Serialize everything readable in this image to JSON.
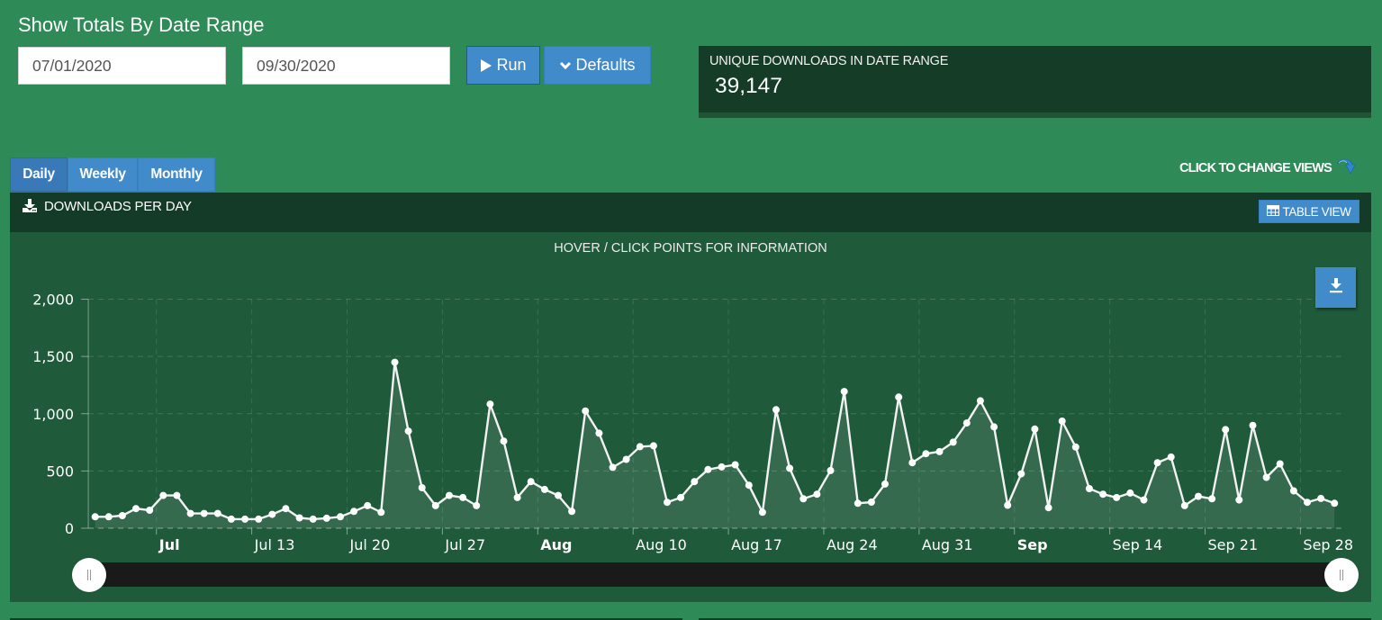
{
  "page": {
    "title": "Show Totals By Date Range"
  },
  "date_range": {
    "start_value": "07/01/2020",
    "end_value": "09/30/2020",
    "run_label": "Run",
    "defaults_label": "Defaults"
  },
  "stat": {
    "label": "UNIQUE DOWNLOADS IN DATE RANGE",
    "value": "39,147"
  },
  "view_tabs": [
    {
      "label": "Daily",
      "active": true
    },
    {
      "label": "Weekly",
      "active": false
    },
    {
      "label": "Monthly",
      "active": false
    }
  ],
  "change_views_hint": "CLICK TO CHANGE VIEWS",
  "panel": {
    "title": "DOWNLOADS PER DAY",
    "table_view_label": "TABLE VIEW"
  },
  "navigator": {
    "range_start": "2020-07-01",
    "range_end": "2020-09-30",
    "selected_fraction": [
      0,
      1
    ]
  },
  "icons": {
    "run": "play-icon",
    "defaults": "chevron-down-icon",
    "change_views": "curved-arrow-down-icon",
    "panel_title": "download-tray-icon",
    "table_view": "table-grid-icon",
    "export": "download-icon",
    "navigator_handle": "grip-icon"
  },
  "colors": {
    "page_background": "#2e8b57",
    "panel_background": "#1f5a3b",
    "panel_header": "#143b27",
    "accent_button": "#428bca",
    "series_line": "#f2f2f2",
    "navigator_track": "#1a1a1a"
  },
  "chart_data": {
    "type": "area",
    "title": "HOVER / CLICK POINTS FOR INFORMATION",
    "xlabel": "",
    "ylabel": "",
    "ylim": [
      0,
      2000
    ],
    "grid": true,
    "legend": "none",
    "markers": true,
    "y_ticks": [
      {
        "value": 0,
        "label": "0"
      },
      {
        "value": 500,
        "label": "500"
      },
      {
        "value": 1000,
        "label": "1,000"
      },
      {
        "value": 1500,
        "label": "1,500"
      },
      {
        "value": 2000,
        "label": "2,000"
      }
    ],
    "x_ticks": [
      {
        "date": "2020-07-06",
        "label": "Jul"
      },
      {
        "date": "2020-07-13",
        "label": "Jul 13"
      },
      {
        "date": "2020-07-20",
        "label": "Jul 20"
      },
      {
        "date": "2020-07-27",
        "label": "Jul 27"
      },
      {
        "date": "2020-08-03",
        "label": "Aug"
      },
      {
        "date": "2020-08-10",
        "label": "Aug 10"
      },
      {
        "date": "2020-08-17",
        "label": "Aug 17"
      },
      {
        "date": "2020-08-24",
        "label": "Aug 24"
      },
      {
        "date": "2020-08-31",
        "label": "Aug 31"
      },
      {
        "date": "2020-09-07",
        "label": "Sep"
      },
      {
        "date": "2020-09-14",
        "label": "Sep 14"
      },
      {
        "date": "2020-09-21",
        "label": "Sep 21"
      },
      {
        "date": "2020-09-28",
        "label": "Sep 28"
      }
    ],
    "series_name": "Downloads",
    "x": [
      "2020-07-01",
      "2020-07-02",
      "2020-07-03",
      "2020-07-04",
      "2020-07-05",
      "2020-07-06",
      "2020-07-07",
      "2020-07-08",
      "2020-07-09",
      "2020-07-10",
      "2020-07-11",
      "2020-07-12",
      "2020-07-13",
      "2020-07-14",
      "2020-07-15",
      "2020-07-16",
      "2020-07-17",
      "2020-07-18",
      "2020-07-19",
      "2020-07-20",
      "2020-07-21",
      "2020-07-22",
      "2020-07-23",
      "2020-07-24",
      "2020-07-25",
      "2020-07-26",
      "2020-07-27",
      "2020-07-28",
      "2020-07-29",
      "2020-07-30",
      "2020-07-31",
      "2020-08-01",
      "2020-08-02",
      "2020-08-03",
      "2020-08-04",
      "2020-08-05",
      "2020-08-06",
      "2020-08-07",
      "2020-08-08",
      "2020-08-09",
      "2020-08-10",
      "2020-08-11",
      "2020-08-12",
      "2020-08-13",
      "2020-08-14",
      "2020-08-15",
      "2020-08-16",
      "2020-08-17",
      "2020-08-18",
      "2020-08-19",
      "2020-08-20",
      "2020-08-21",
      "2020-08-22",
      "2020-08-23",
      "2020-08-24",
      "2020-08-25",
      "2020-08-26",
      "2020-08-27",
      "2020-08-28",
      "2020-08-29",
      "2020-08-30",
      "2020-08-31",
      "2020-09-01",
      "2020-09-02",
      "2020-09-03",
      "2020-09-04",
      "2020-09-05",
      "2020-09-06",
      "2020-09-07",
      "2020-09-08",
      "2020-09-09",
      "2020-09-10",
      "2020-09-11",
      "2020-09-12",
      "2020-09-13",
      "2020-09-14",
      "2020-09-15",
      "2020-09-16",
      "2020-09-17",
      "2020-09-18",
      "2020-09-19",
      "2020-09-20",
      "2020-09-21",
      "2020-09-22",
      "2020-09-23",
      "2020-09-24",
      "2020-09-25",
      "2020-09-26",
      "2020-09-27",
      "2020-09-28",
      "2020-09-29",
      "2020-09-30"
    ],
    "values": [
      100,
      100,
      110,
      171,
      157,
      286,
      286,
      129,
      129,
      129,
      79,
      79,
      79,
      121,
      171,
      90,
      79,
      87,
      100,
      147,
      197,
      139,
      1449,
      848,
      354,
      197,
      286,
      268,
      197,
      1084,
      761,
      268,
      407,
      339,
      286,
      147,
      1024,
      830,
      531,
      601,
      712,
      720,
      226,
      268,
      407,
      512,
      535,
      554,
      376,
      139,
      1035,
      523,
      257,
      297,
      504,
      1194,
      218,
      228,
      386,
      1145,
      572,
      651,
      669,
      751,
      919,
      1113,
      885,
      200,
      475,
      866,
      179,
      935,
      709,
      346,
      297,
      268,
      307,
      247,
      572,
      622,
      197,
      278,
      257,
      861,
      247,
      898,
      444,
      562,
      326,
      226,
      260,
      218
    ]
  }
}
